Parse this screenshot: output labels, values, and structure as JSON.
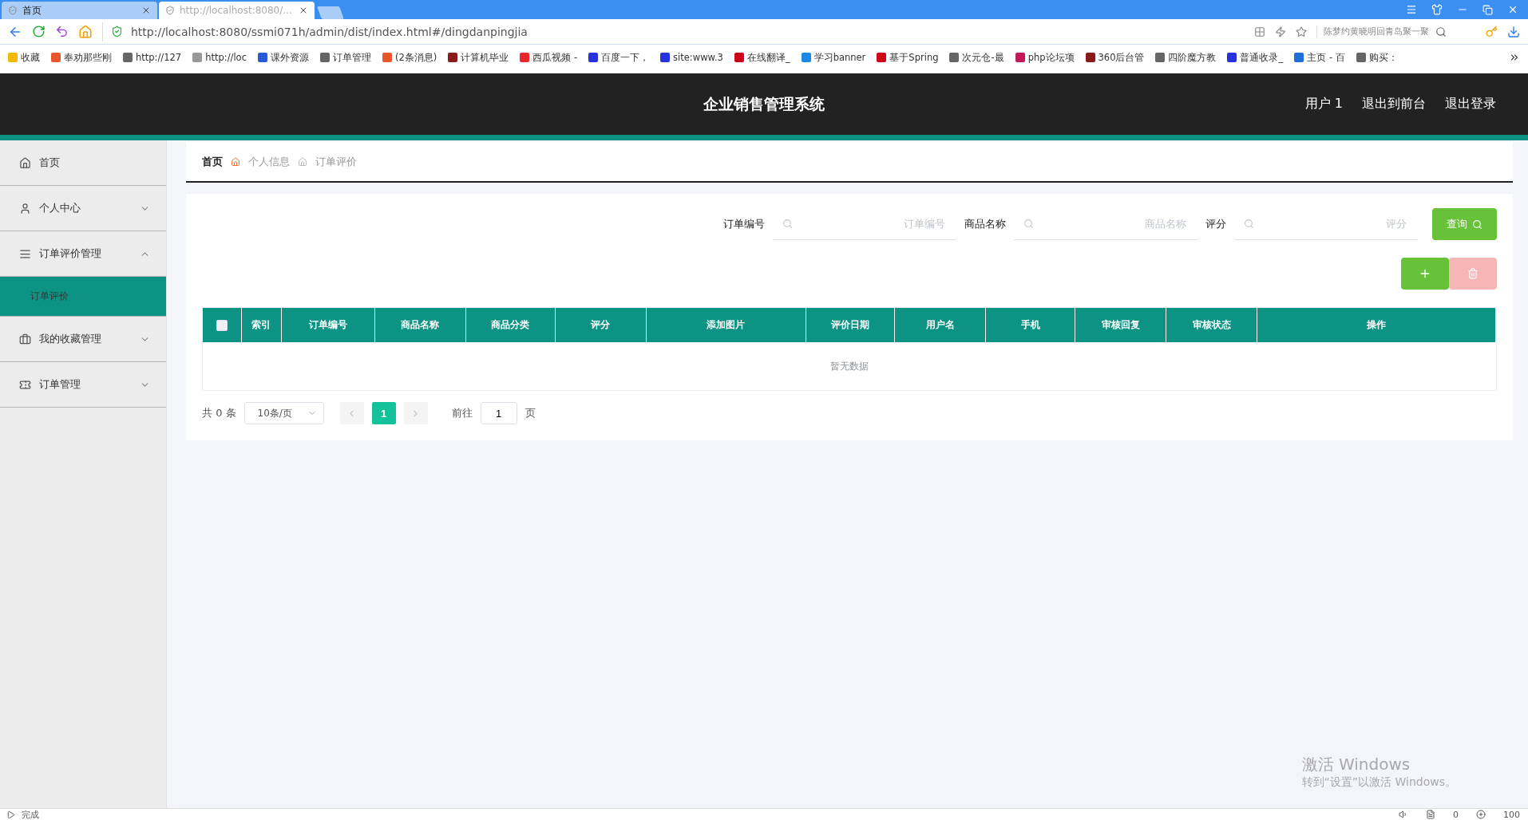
{
  "browser": {
    "tabs": [
      {
        "title": "首页",
        "selected": false
      },
      {
        "title": "http://localhost:8080/...",
        "selected": true
      }
    ],
    "url": "http://localhost:8080/ssmi071h/admin/dist/index.html#/dingdanpingjia",
    "search_text": "陈梦约黄晓明回青岛聚一聚",
    "bookmarks": [
      {
        "label": "收藏",
        "color": "#f5b800"
      },
      {
        "label": "奉劝那些刚",
        "color": "#e8552c"
      },
      {
        "label": "http://127",
        "color": "#666666"
      },
      {
        "label": "http://loc",
        "color": "#999999"
      },
      {
        "label": "课外资源",
        "color": "#2a5bd7"
      },
      {
        "label": "订单管理",
        "color": "#666666"
      },
      {
        "label": "(2条消息)",
        "color": "#e8552c"
      },
      {
        "label": "计算机毕业",
        "color": "#8b1a1a"
      },
      {
        "label": "西瓜视频 -",
        "color": "#e8262c"
      },
      {
        "label": "百度一下，",
        "color": "#2932e1"
      },
      {
        "label": "site:www.3",
        "color": "#2932e1"
      },
      {
        "label": "在线翻译_",
        "color": "#d0021b"
      },
      {
        "label": "学习banner",
        "color": "#1e88e5"
      },
      {
        "label": "基于Spring",
        "color": "#d0021b"
      },
      {
        "label": "次元仓-最",
        "color": "#666666"
      },
      {
        "label": "php论坛项",
        "color": "#c2185b"
      },
      {
        "label": "360后台管",
        "color": "#8b1a1a"
      },
      {
        "label": "四阶魔方教",
        "color": "#666666"
      },
      {
        "label": "普通收录_",
        "color": "#2932e1"
      },
      {
        "label": "主页 - 百",
        "color": "#1e6fd9"
      },
      {
        "label": "购买：",
        "color": "#666666"
      }
    ]
  },
  "header": {
    "title": "企业销售管理系统",
    "links": [
      "用户 1",
      "退出到前台",
      "退出登录"
    ]
  },
  "sidebar": {
    "items": [
      {
        "label": "首页",
        "kind": "home"
      },
      {
        "label": "个人中心",
        "kind": "user",
        "expanded": false
      },
      {
        "label": "订单评价管理",
        "kind": "list",
        "expanded": true,
        "children": [
          {
            "label": "订单评价",
            "selected": true
          }
        ]
      },
      {
        "label": "我的收藏管理",
        "kind": "briefcase",
        "expanded": false
      },
      {
        "label": "订单管理",
        "kind": "ticket",
        "expanded": false
      }
    ]
  },
  "breadcrumb": [
    "首页",
    "个人信息",
    "订单评价"
  ],
  "filters": [
    {
      "label": "订单编号",
      "placeholder": "订单编号"
    },
    {
      "label": "商品名称",
      "placeholder": "商品名称"
    },
    {
      "label": "评分",
      "placeholder": "评分"
    }
  ],
  "query_button": "查询",
  "actions": [
    {
      "kind": "add",
      "disabled": false
    },
    {
      "kind": "delete",
      "disabled": true
    }
  ],
  "table": {
    "select_all": {
      "checked": false
    },
    "columns": [
      "索引",
      "订单编号",
      "商品名称",
      "商品分类",
      "评分",
      "添加图片",
      "评价日期",
      "用户名",
      "手机",
      "审核回复",
      "审核状态",
      "操作"
    ],
    "empty_text": "暂无数据"
  },
  "pagination": {
    "total": "共 0 条",
    "page_size": "10条/页",
    "pages": [
      {
        "label": "1",
        "selected": true
      }
    ],
    "goto_label": "前往",
    "goto_value": "1",
    "goto_suffix": "页"
  },
  "status_bar": {
    "text": "完成",
    "ad_count": "0",
    "zoom": "100"
  },
  "os_notice": {
    "title": "激活 Windows",
    "text": "转到“设置”以激活 Windows。"
  }
}
